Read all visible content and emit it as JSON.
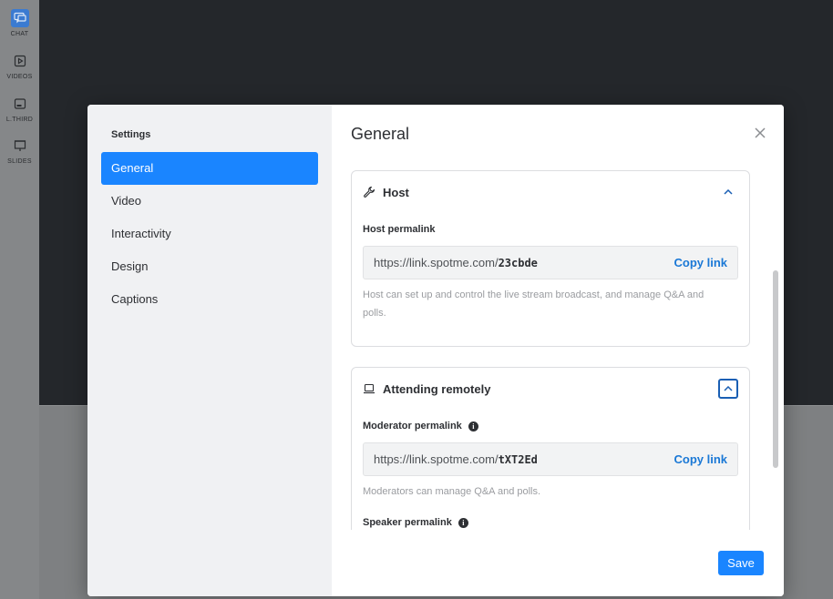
{
  "sidebar_rail": {
    "items": [
      {
        "label": "CHAT",
        "icon": "chat-icon",
        "active": true
      },
      {
        "label": "VIDEOS",
        "icon": "video-icon",
        "active": false
      },
      {
        "label": "L.THIRD",
        "icon": "lower-third-icon",
        "active": false
      },
      {
        "label": "SLIDES",
        "icon": "slides-icon",
        "active": false
      }
    ]
  },
  "modal": {
    "side_title": "Settings",
    "nav": [
      {
        "label": "General",
        "active": true
      },
      {
        "label": "Video",
        "active": false
      },
      {
        "label": "Interactivity",
        "active": false
      },
      {
        "label": "Design",
        "active": false
      },
      {
        "label": "Captions",
        "active": false
      }
    ],
    "title": "General",
    "save_label": "Save",
    "sections": {
      "host": {
        "title": "Host",
        "icon": "wrench-icon",
        "field_label": "Host permalink",
        "link_prefix": "https://link.spotme.com/",
        "link_code": "23cbde",
        "copy_label": "Copy link",
        "help": "Host can set up and control the live stream broadcast, and manage Q&A and polls."
      },
      "remote": {
        "title": "Attending remotely",
        "icon": "laptop-icon",
        "moderator_label": "Moderator permalink",
        "moderator_link_prefix": "https://link.spotme.com/",
        "moderator_link_code": "tXT2Ed",
        "copy_label": "Copy link",
        "moderator_help": "Moderators can manage Q&A and polls.",
        "speaker_label": "Speaker permalink"
      }
    }
  },
  "colors": {
    "accent": "#1a85ff",
    "link": "#1a78d6",
    "stage_dark": "#24272b"
  }
}
